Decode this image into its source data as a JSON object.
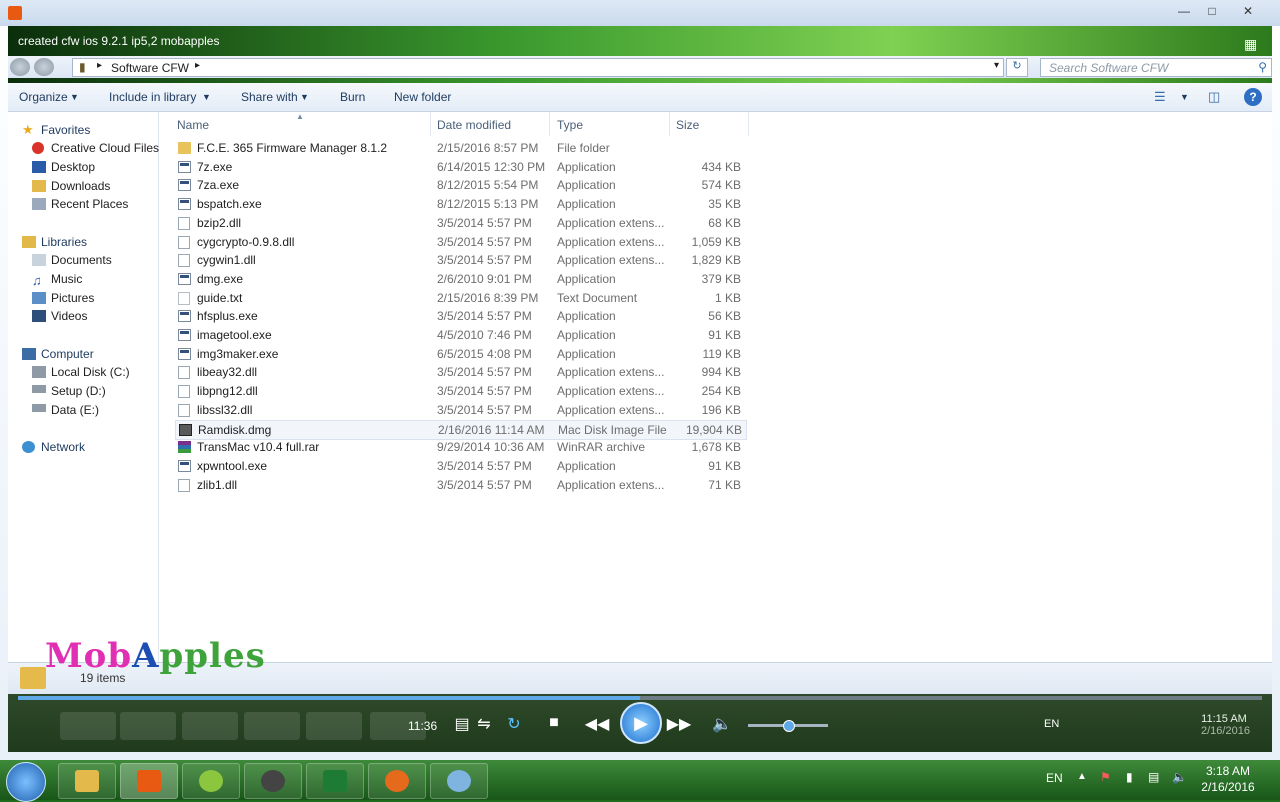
{
  "player_window": {
    "video_title": "created cfw ios 9.2.1 ip5,2 mobapples"
  },
  "explorer": {
    "breadcrumb": "Software CFW",
    "search_placeholder": "Search Software CFW",
    "toolbar": {
      "organize": "Organize",
      "include_in_library": "Include in library",
      "share_with": "Share with",
      "burn": "Burn",
      "new_folder": "New folder",
      "help": "?"
    },
    "nav": {
      "favorites": "Favorites",
      "creative_cloud": "Creative Cloud Files",
      "desktop": "Desktop",
      "downloads": "Downloads",
      "recent_places": "Recent Places",
      "libraries": "Libraries",
      "documents": "Documents",
      "music": "Music",
      "pictures": "Pictures",
      "videos": "Videos",
      "computer": "Computer",
      "local_disk": "Local Disk (C:)",
      "setup": "Setup (D:)",
      "data": "Data (E:)",
      "network": "Network"
    },
    "columns": {
      "name": "Name",
      "date": "Date modified",
      "type": "Type",
      "size": "Size"
    },
    "files": [
      {
        "name": "F.C.E. 365 Firmware Manager 8.1.2",
        "date": "2/15/2016 8:57 PM",
        "type": "File folder",
        "size": "",
        "icon": "folder"
      },
      {
        "name": "7z.exe",
        "date": "6/14/2015 12:30 PM",
        "type": "Application",
        "size": "434 KB",
        "icon": "app"
      },
      {
        "name": "7za.exe",
        "date": "8/12/2015 5:54 PM",
        "type": "Application",
        "size": "574 KB",
        "icon": "app"
      },
      {
        "name": "bspatch.exe",
        "date": "8/12/2015 5:13 PM",
        "type": "Application",
        "size": "35 KB",
        "icon": "app"
      },
      {
        "name": "bzip2.dll",
        "date": "3/5/2014 5:57 PM",
        "type": "Application extens...",
        "size": "68 KB",
        "icon": "dll"
      },
      {
        "name": "cygcrypto-0.9.8.dll",
        "date": "3/5/2014 5:57 PM",
        "type": "Application extens...",
        "size": "1,059 KB",
        "icon": "dll"
      },
      {
        "name": "cygwin1.dll",
        "date": "3/5/2014 5:57 PM",
        "type": "Application extens...",
        "size": "1,829 KB",
        "icon": "dll"
      },
      {
        "name": "dmg.exe",
        "date": "2/6/2010 9:01 PM",
        "type": "Application",
        "size": "379 KB",
        "icon": "app"
      },
      {
        "name": "guide.txt",
        "date": "2/15/2016 8:39 PM",
        "type": "Text Document",
        "size": "1 KB",
        "icon": "txt"
      },
      {
        "name": "hfsplus.exe",
        "date": "3/5/2014 5:57 PM",
        "type": "Application",
        "size": "56 KB",
        "icon": "app"
      },
      {
        "name": "imagetool.exe",
        "date": "4/5/2010 7:46 PM",
        "type": "Application",
        "size": "91 KB",
        "icon": "app"
      },
      {
        "name": "img3maker.exe",
        "date": "6/5/2015 4:08 PM",
        "type": "Application",
        "size": "119 KB",
        "icon": "app"
      },
      {
        "name": "libeay32.dll",
        "date": "3/5/2014 5:57 PM",
        "type": "Application extens...",
        "size": "994 KB",
        "icon": "dll"
      },
      {
        "name": "libpng12.dll",
        "date": "3/5/2014 5:57 PM",
        "type": "Application extens...",
        "size": "254 KB",
        "icon": "dll"
      },
      {
        "name": "libssl32.dll",
        "date": "3/5/2014 5:57 PM",
        "type": "Application extens...",
        "size": "196 KB",
        "icon": "dll"
      },
      {
        "name": "Ramdisk.dmg",
        "date": "2/16/2016 11:14 AM",
        "type": "Mac Disk Image File",
        "size": "19,904 KB",
        "icon": "dmg"
      },
      {
        "name": "TransMac v10.4 full.rar",
        "date": "9/29/2014 10:36 AM",
        "type": "WinRAR archive",
        "size": "1,678 KB",
        "icon": "rar"
      },
      {
        "name": "xpwntool.exe",
        "date": "3/5/2014 5:57 PM",
        "type": "Application",
        "size": "91 KB",
        "icon": "app"
      },
      {
        "name": "zlib1.dll",
        "date": "3/5/2014 5:57 PM",
        "type": "Application extens...",
        "size": "71 KB",
        "icon": "dll"
      }
    ],
    "status": "19 items"
  },
  "watermark": {
    "part1": "Mob",
    "part2": "A",
    "part3": "pples"
  },
  "player": {
    "elapsed": "11:36",
    "progress": 0.5,
    "volume": 0.5,
    "lang": "EN",
    "clock_time": "11:15 AM",
    "clock_date": "2/16/2016"
  },
  "taskbar": {
    "lang": "EN",
    "time": "3:18 AM",
    "date": "2/16/2016"
  },
  "colors": {
    "accent": "#2e6fc4",
    "progress": "#5fa9e8",
    "logo_pink": "#e02fb3",
    "logo_green": "#3ea33a"
  }
}
